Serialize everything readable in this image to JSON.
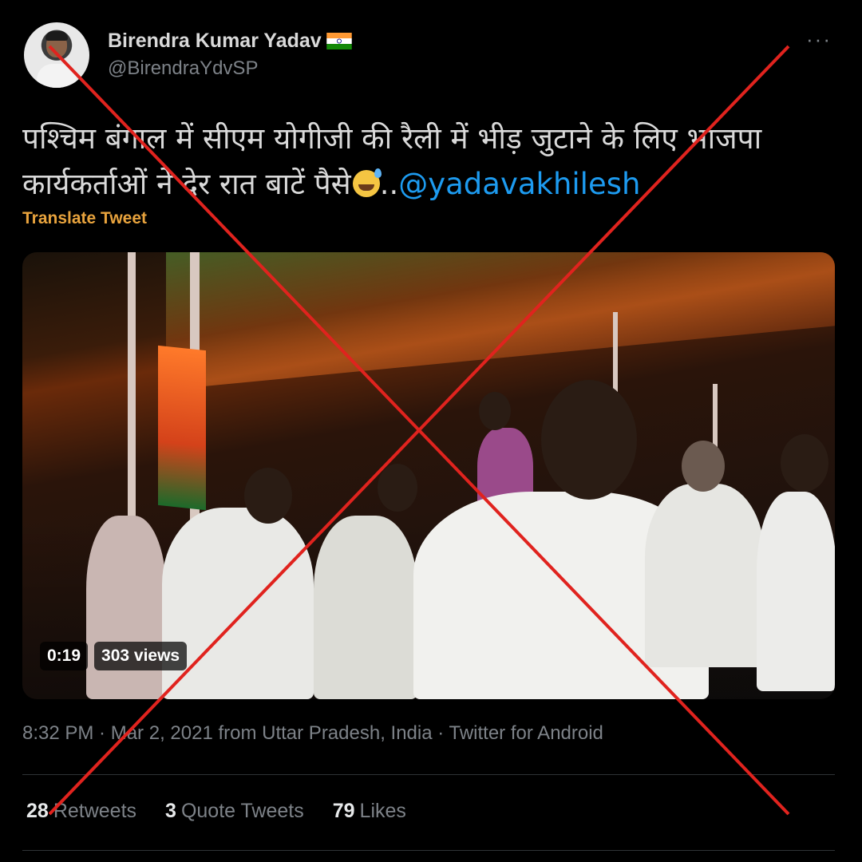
{
  "author": {
    "display_name": "Birendra Kumar Yadav",
    "handle": "@BirendraYdvSP",
    "flag_icon": "india-flag-icon"
  },
  "tweet": {
    "text_line1": "पश्चिम बंगाल में सीएम योगीजी की रैली में भीड़ जुटाने के लिए भाजपा",
    "text_line2_prefix": "कार्यकर्ताओं ने देर रात बाटें पैसे",
    "text_emoji": "grinning-sweat-emoji",
    "text_separator": "..",
    "mention": "@yadavakhilesh",
    "translate_label": "Translate Tweet"
  },
  "video": {
    "duration": "0:19",
    "views": "303 views"
  },
  "meta": {
    "time": "8:32 PM",
    "sep1": " · ",
    "date": "Mar 2, 2021 from Uttar Pradesh, India",
    "sep2": " · ",
    "source": "Twitter for Android"
  },
  "stats": [
    {
      "count": "28",
      "label": "Retweets"
    },
    {
      "count": "3",
      "label": "Quote Tweets"
    },
    {
      "count": "79",
      "label": "Likes"
    }
  ],
  "colors": {
    "background": "#000000",
    "mention": "#1d9bf0",
    "translate": "#e8a33d",
    "cross": "#e0231e"
  }
}
